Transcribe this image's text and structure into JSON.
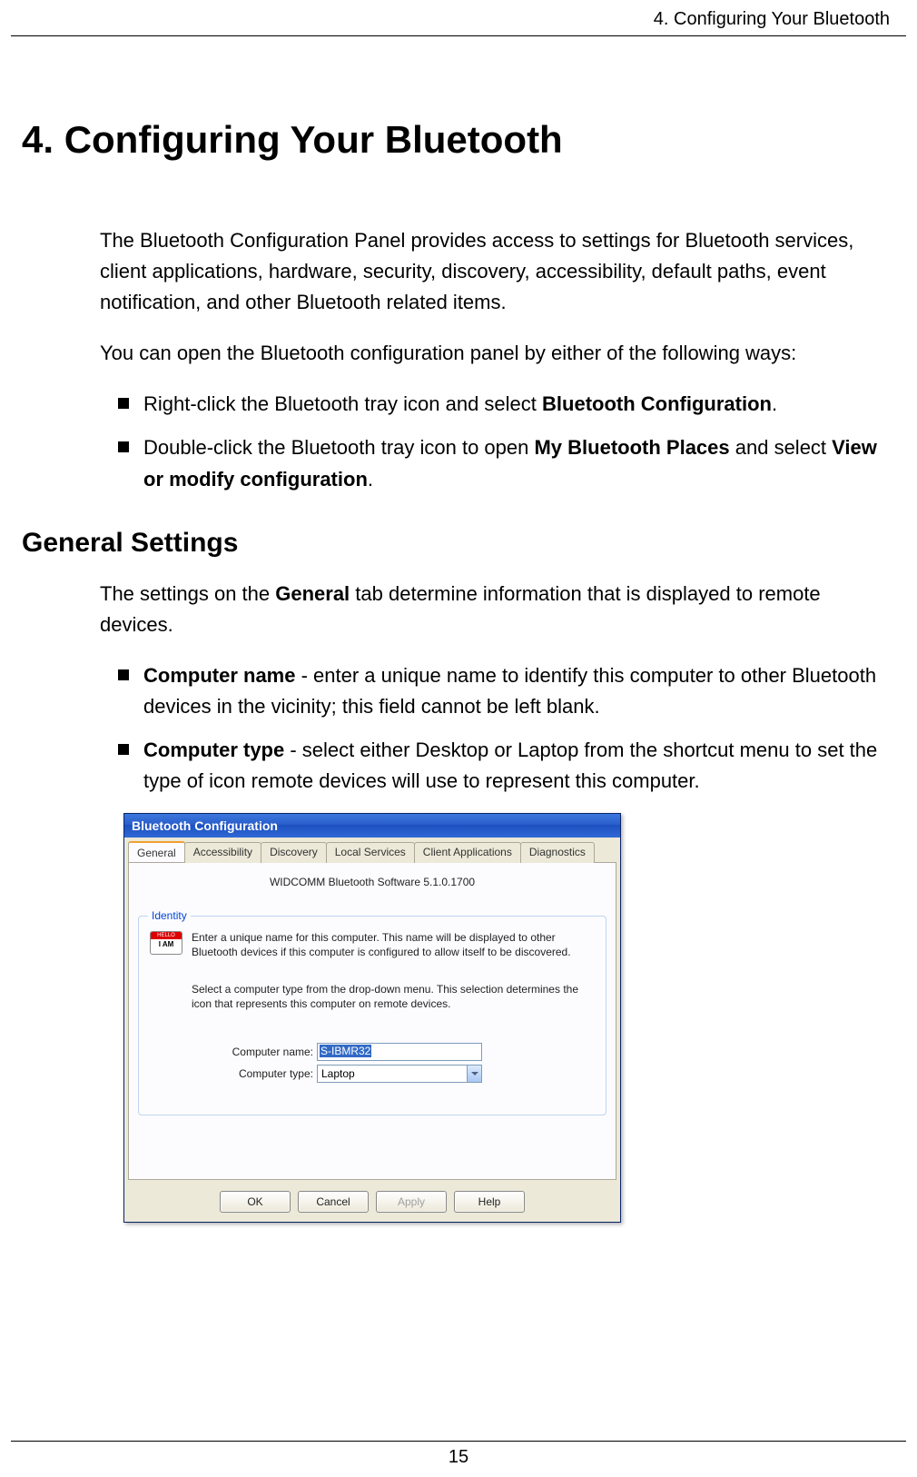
{
  "header_text": "4. Configuring Your Bluetooth",
  "heading": "4. Configuring Your Bluetooth",
  "intro_para": "The Bluetooth Configuration Panel provides access to settings for Bluetooth services, client applications, hardware, security, discovery, accessibility, default paths, event notification, and other Bluetooth related items.",
  "open_para": "You can open the Bluetooth configuration panel by either of the following ways:",
  "bullets_open": {
    "b1_pre": "Right-click the Bluetooth tray icon and select ",
    "b1_bold": "Bluetooth Configuration",
    "b1_post": ".",
    "b2_pre": "Double-click the Bluetooth tray icon to open ",
    "b2_bold1": "My Bluetooth Places",
    "b2_mid": " and select ",
    "b2_bold2": "View or modify configuration",
    "b2_post": "."
  },
  "section_heading": "General Settings",
  "general_para_pre": "The settings on the ",
  "general_para_bold": "General",
  "general_para_post": " tab determine information that is displayed to remote devices.",
  "bullets_general": {
    "b1_bold": "Computer name",
    "b1_rest": " - enter a unique name to identify this computer to other Bluetooth devices in the vicinity; this field cannot be left blank.",
    "b2_bold": "Computer type",
    "b2_rest": " - select either Desktop or Laptop from the shortcut menu to set the type of icon remote devices will use to represent this computer."
  },
  "dialog": {
    "title": "Bluetooth Configuration",
    "tabs": [
      "General",
      "Accessibility",
      "Discovery",
      "Local Services",
      "Client Applications",
      "Diagnostics"
    ],
    "software_line": "WIDCOMM Bluetooth Software 5.1.0.1700",
    "group_legend": "Identity",
    "badge_hello": "HELLO",
    "badge_iam": "I AM",
    "identity_text1": "Enter a unique name for this computer.  This name will be displayed to other Bluetooth devices if this computer is configured to allow itself to be discovered.",
    "identity_text2": "Select a computer type from the drop-down menu.  This selection determines the icon that represents this computer on remote devices.",
    "label_name": "Computer name:",
    "value_name": "S-IBMR32",
    "label_type": "Computer type:",
    "value_type": "Laptop",
    "buttons": {
      "ok": "OK",
      "cancel": "Cancel",
      "apply": "Apply",
      "help": "Help"
    }
  },
  "page_number": "15"
}
